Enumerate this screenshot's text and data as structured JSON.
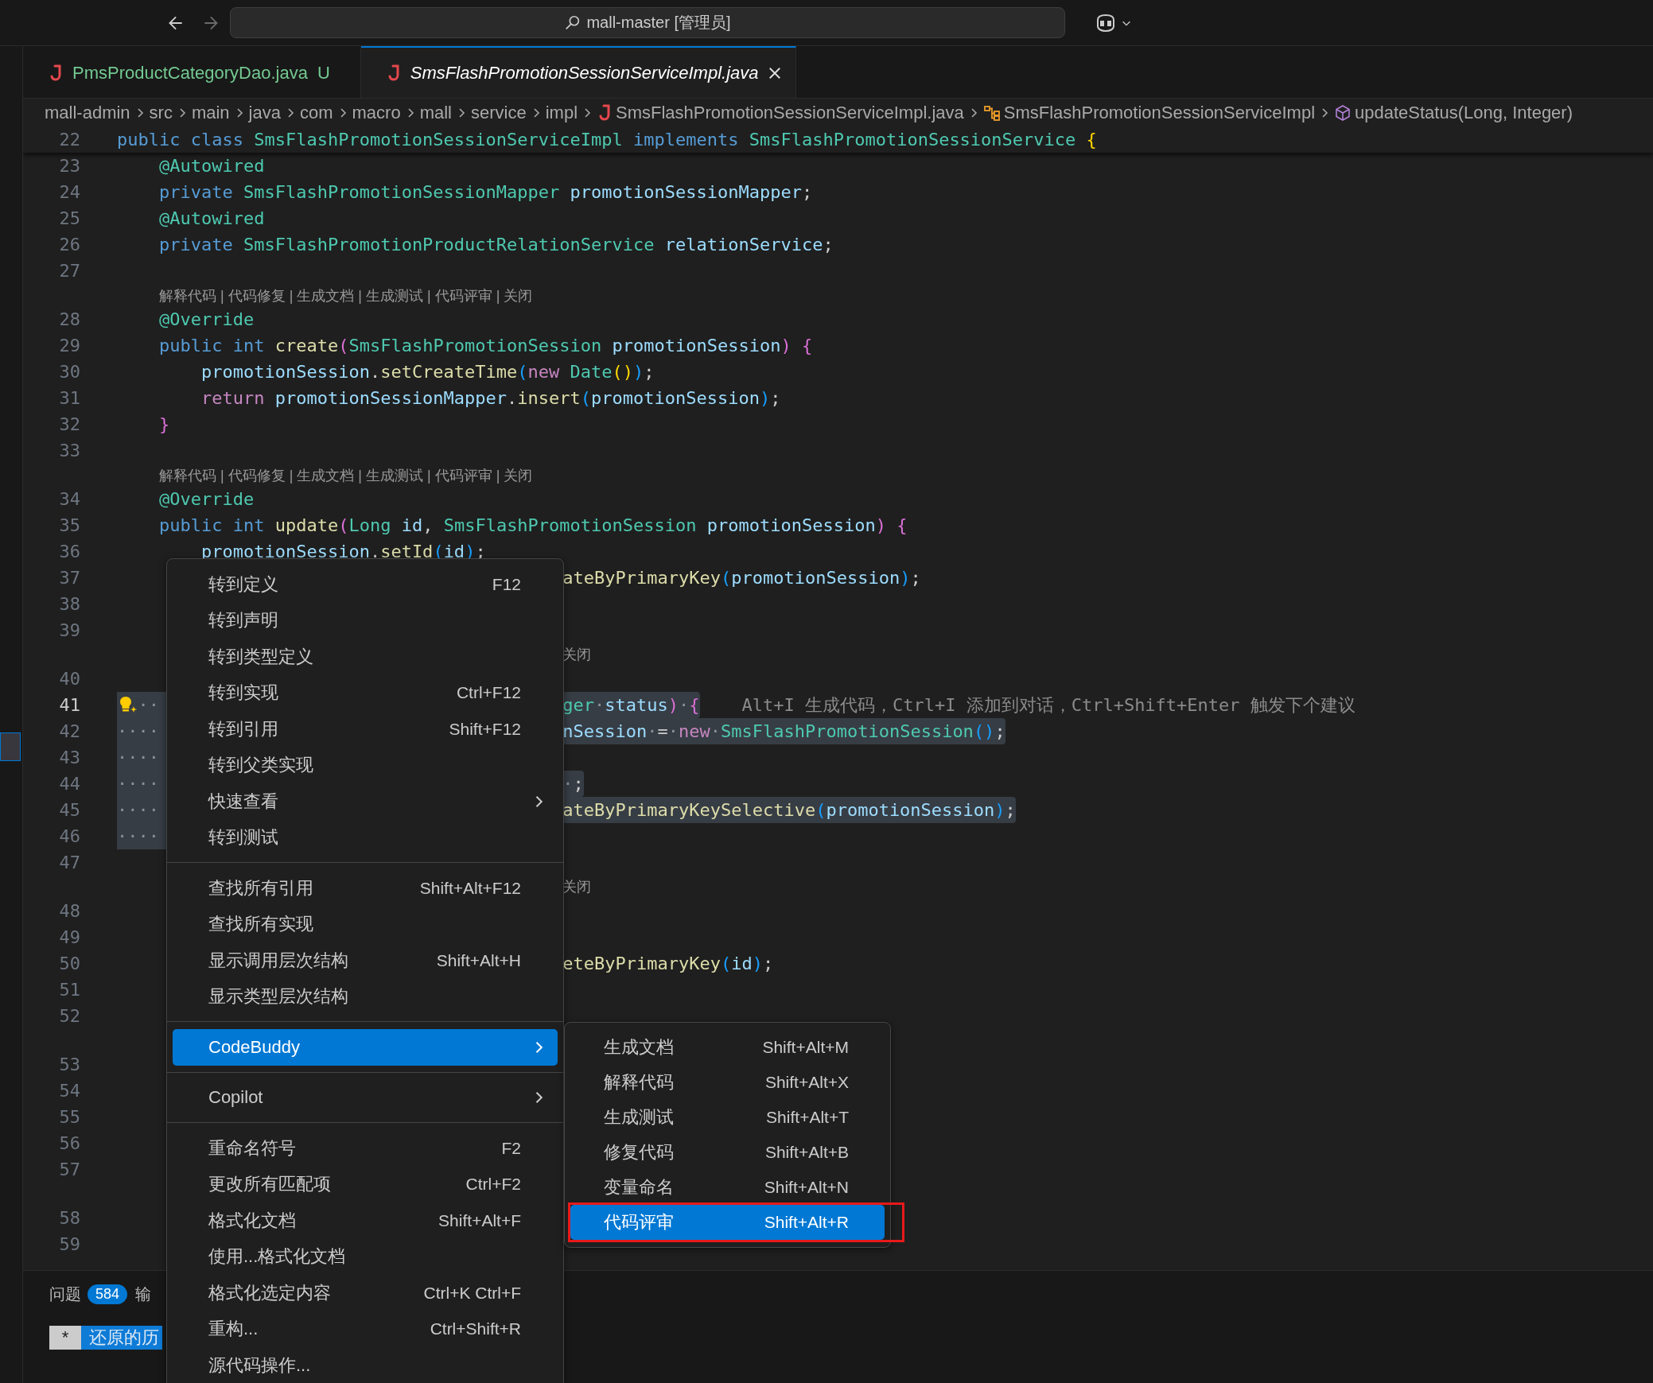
{
  "title_bar": {
    "back": {
      "disabled": false
    },
    "forward": {
      "disabled": true
    },
    "search": {
      "value": "mall-master [管理员]"
    }
  },
  "tabs": [
    {
      "label": "PmsProductCategoryDao.java",
      "status": "U",
      "untracked": true,
      "preview": false,
      "selected": false
    },
    {
      "label": "SmsFlashPromotionSessionServiceImpl.java",
      "untracked": false,
      "preview": true,
      "selected": true
    }
  ],
  "breadcrumb": [
    {
      "label": "mall-admin",
      "kind": "folder"
    },
    {
      "label": "src",
      "kind": "folder"
    },
    {
      "label": "main",
      "kind": "folder"
    },
    {
      "label": "java",
      "kind": "folder"
    },
    {
      "label": "com",
      "kind": "folder"
    },
    {
      "label": "macro",
      "kind": "folder"
    },
    {
      "label": "mall",
      "kind": "folder"
    },
    {
      "label": "service",
      "kind": "folder"
    },
    {
      "label": "impl",
      "kind": "folder"
    },
    {
      "label": "SmsFlashPromotionSessionServiceImpl.java",
      "kind": "file"
    },
    {
      "label": "SmsFlashPromotionSessionServiceImpl",
      "kind": "class"
    },
    {
      "label": "updateStatus(Long, Integer)",
      "kind": "method"
    }
  ],
  "editor": {
    "rows": [
      {
        "kind": "line",
        "number": "22",
        "sticky": true,
        "current": false,
        "selected": false,
        "left": [
          {
            "text": "public class ",
            "kind": "kw"
          },
          {
            "text": "SmsFlashPromotionSessionServiceImpl ",
            "kind": "type"
          },
          {
            "text": "implements ",
            "kind": "kw"
          },
          {
            "text": "SmsFlashPromotionSessionService ",
            "kind": "type"
          },
          {
            "text": "{",
            "kind": "b1"
          }
        ]
      },
      {
        "kind": "line",
        "number": "23",
        "current": false,
        "selected": false,
        "left": [
          {
            "text": "    @Autowired",
            "kind": "type"
          }
        ]
      },
      {
        "kind": "line",
        "number": "24",
        "current": false,
        "selected": false,
        "left": [
          {
            "text": "    private ",
            "kind": "kw"
          },
          {
            "text": "SmsFlashPromotionSessionMapper ",
            "kind": "type"
          },
          {
            "text": "promotionSessionMapper",
            "kind": "var"
          },
          {
            "text": ";",
            "kind": "punc"
          }
        ]
      },
      {
        "kind": "line",
        "number": "25",
        "current": false,
        "selected": false,
        "left": [
          {
            "text": "    @Autowired",
            "kind": "type"
          }
        ]
      },
      {
        "kind": "line",
        "number": "26",
        "current": false,
        "selected": false,
        "left": [
          {
            "text": "    private ",
            "kind": "kw"
          },
          {
            "text": "SmsFlashPromotionProductRelationService ",
            "kind": "type"
          },
          {
            "text": "relationService",
            "kind": "var"
          },
          {
            "text": ";",
            "kind": "punc"
          }
        ]
      },
      {
        "kind": "line",
        "number": "27",
        "current": false,
        "selected": false
      },
      {
        "kind": "lens",
        "left": "解释代码 | 代码修复 | 生成文档 | 生成测试 | 代码评审 | 关闭"
      },
      {
        "kind": "line",
        "number": "28",
        "current": false,
        "selected": false,
        "left": [
          {
            "text": "    @Override",
            "kind": "type"
          }
        ]
      },
      {
        "kind": "line",
        "number": "29",
        "current": false,
        "selected": false,
        "left": [
          {
            "text": "    public int ",
            "kind": "kw"
          },
          {
            "text": "create",
            "kind": "fn"
          },
          {
            "text": "(",
            "kind": "b2"
          },
          {
            "text": "SmsFlashPromotionSession ",
            "kind": "type"
          },
          {
            "text": "promotionSession",
            "kind": "var"
          },
          {
            "text": ") {",
            "kind": "b2"
          }
        ]
      },
      {
        "kind": "line",
        "number": "30",
        "current": false,
        "selected": false,
        "left": [
          {
            "text": "        promotionSession",
            "kind": "var"
          },
          {
            "text": ".",
            "kind": "punc"
          },
          {
            "text": "setCreateTime",
            "kind": "fn"
          },
          {
            "text": "(",
            "kind": "b3"
          },
          {
            "text": "new ",
            "kind": "ctrl"
          },
          {
            "text": "Date",
            "kind": "type"
          },
          {
            "text": "()",
            "kind": "b1"
          },
          {
            "text": ")",
            "kind": "b3"
          },
          {
            "text": ";",
            "kind": "punc"
          }
        ]
      },
      {
        "kind": "line",
        "number": "31",
        "current": false,
        "selected": false,
        "left": [
          {
            "text": "        return ",
            "kind": "ctrl"
          },
          {
            "text": "promotionSessionMapper",
            "kind": "var"
          },
          {
            "text": ".",
            "kind": "punc"
          },
          {
            "text": "insert",
            "kind": "fn"
          },
          {
            "text": "(",
            "kind": "b3"
          },
          {
            "text": "promotionSession",
            "kind": "var"
          },
          {
            "text": ")",
            "kind": "b3"
          },
          {
            "text": ";",
            "kind": "punc"
          }
        ]
      },
      {
        "kind": "line",
        "number": "32",
        "current": false,
        "selected": false,
        "left": [
          {
            "text": "    }",
            "kind": "b2"
          }
        ]
      },
      {
        "kind": "line",
        "number": "33",
        "current": false,
        "selected": false
      },
      {
        "kind": "lens",
        "left": "解释代码 | 代码修复 | 生成文档 | 生成测试 | 代码评审 | 关闭"
      },
      {
        "kind": "line",
        "number": "34",
        "current": false,
        "selected": false,
        "left": [
          {
            "text": "    @Override",
            "kind": "type"
          }
        ]
      },
      {
        "kind": "line",
        "number": "35",
        "current": false,
        "selected": false,
        "left": [
          {
            "text": "    public int ",
            "kind": "kw"
          },
          {
            "text": "update",
            "kind": "fn"
          },
          {
            "text": "(",
            "kind": "b2"
          },
          {
            "text": "Long ",
            "kind": "type"
          },
          {
            "text": "id",
            "kind": "var"
          },
          {
            "text": ", ",
            "kind": "punc"
          },
          {
            "text": "SmsFlashPromotionSession ",
            "kind": "type"
          },
          {
            "text": "promotionSession",
            "kind": "var"
          },
          {
            "text": ") {",
            "kind": "b2"
          }
        ]
      },
      {
        "kind": "line",
        "number": "36",
        "current": false,
        "selected": false,
        "left": [
          {
            "text": "        promotionSession",
            "kind": "var"
          },
          {
            "text": ".",
            "kind": "punc"
          },
          {
            "text": "setId",
            "kind": "fn"
          },
          {
            "text": "(",
            "kind": "b3"
          },
          {
            "text": "id",
            "kind": "var"
          },
          {
            "text": ")",
            "kind": "b3"
          },
          {
            "text": ";",
            "kind": "punc"
          }
        ]
      },
      {
        "kind": "line",
        "number": "37",
        "current": false,
        "selected": false,
        "right": [
          {
            "text": "ateByPrimaryKey",
            "kind": "fn"
          },
          {
            "text": "(",
            "kind": "b3"
          },
          {
            "text": "promotionSession",
            "kind": "var"
          },
          {
            "text": ")",
            "kind": "b3"
          },
          {
            "text": ";",
            "kind": "punc"
          }
        ]
      },
      {
        "kind": "line",
        "number": "38",
        "current": false,
        "selected": false
      },
      {
        "kind": "line",
        "number": "39",
        "current": false,
        "selected": false
      },
      {
        "kind": "lens",
        "right": "关闭"
      },
      {
        "kind": "line",
        "number": "40",
        "current": false,
        "selected": false
      },
      {
        "kind": "line",
        "number": "41",
        "current": true,
        "selected": true,
        "lightbulb": true,
        "left": [
          {
            "text": "  ··",
            "kind": "ws"
          }
        ],
        "right": [
          {
            "text": "ger",
            "kind": "type"
          },
          {
            "text": "·",
            "kind": "ws"
          },
          {
            "text": "status",
            "kind": "var"
          },
          {
            "text": ")",
            "kind": "b2"
          },
          {
            "text": "·",
            "kind": "ws"
          },
          {
            "text": "{",
            "kind": "b2"
          }
        ],
        "hint": "Alt+I 生成代码，Ctrl+I 添加到对话，Ctrl+Shift+Enter 触发下个建议"
      },
      {
        "kind": "line",
        "number": "42",
        "current": false,
        "selected": true,
        "left": [
          {
            "text": "····",
            "kind": "ws"
          }
        ],
        "right": [
          {
            "text": "nSession",
            "kind": "var"
          },
          {
            "text": "·",
            "kind": "ws"
          },
          {
            "text": "=",
            "kind": "punc"
          },
          {
            "text": "·",
            "kind": "ws"
          },
          {
            "text": "new",
            "kind": "ctrl"
          },
          {
            "text": "·",
            "kind": "ws"
          },
          {
            "text": "SmsFlashPromotionSession",
            "kind": "type"
          },
          {
            "text": "()",
            "kind": "b3"
          },
          {
            "text": ";",
            "kind": "punc"
          }
        ]
      },
      {
        "kind": "line",
        "number": "43",
        "current": false,
        "selected": true,
        "left": [
          {
            "text": "····",
            "kind": "ws"
          }
        ]
      },
      {
        "kind": "line",
        "number": "44",
        "current": false,
        "selected": true,
        "left": [
          {
            "text": "····",
            "kind": "ws"
          }
        ],
        "right": [
          {
            "text": "·",
            "kind": "ws"
          },
          {
            "text": ";",
            "kind": "punc"
          }
        ]
      },
      {
        "kind": "line",
        "number": "45",
        "current": false,
        "selected": true,
        "left": [
          {
            "text": "····",
            "kind": "ws"
          }
        ],
        "right": [
          {
            "text": "ateByPrimaryKeySelective",
            "kind": "fn"
          },
          {
            "text": "(",
            "kind": "b3"
          },
          {
            "text": "promotionSession",
            "kind": "var"
          },
          {
            "text": ")",
            "kind": "b3"
          },
          {
            "text": ";",
            "kind": "punc"
          }
        ]
      },
      {
        "kind": "line",
        "number": "46",
        "current": false,
        "selected": true,
        "left": [
          {
            "text": "····",
            "kind": "ws"
          }
        ]
      },
      {
        "kind": "line",
        "number": "47",
        "current": false,
        "selected": false
      },
      {
        "kind": "lens",
        "right": "关闭"
      },
      {
        "kind": "line",
        "number": "48",
        "current": false,
        "selected": false
      },
      {
        "kind": "line",
        "number": "49",
        "current": false,
        "selected": false
      },
      {
        "kind": "line",
        "number": "50",
        "current": false,
        "selected": false,
        "right": [
          {
            "text": "eteByPrimaryKey",
            "kind": "fn"
          },
          {
            "text": "(",
            "kind": "b3"
          },
          {
            "text": "id",
            "kind": "var"
          },
          {
            "text": ")",
            "kind": "b3"
          },
          {
            "text": ";",
            "kind": "punc"
          }
        ]
      },
      {
        "kind": "line",
        "number": "51",
        "current": false,
        "selected": false
      },
      {
        "kind": "line",
        "number": "52",
        "current": false,
        "selected": false
      },
      {
        "kind": "lens"
      },
      {
        "kind": "line",
        "number": "53",
        "current": false,
        "selected": false
      },
      {
        "kind": "line",
        "number": "54",
        "current": false,
        "selected": false
      },
      {
        "kind": "line",
        "number": "55",
        "current": false,
        "selected": false
      },
      {
        "kind": "line",
        "number": "56",
        "current": false,
        "selected": false
      },
      {
        "kind": "line",
        "number": "57",
        "current": false,
        "selected": false
      },
      {
        "kind": "lens"
      },
      {
        "kind": "line",
        "number": "58",
        "current": false,
        "selected": false
      },
      {
        "kind": "line",
        "number": "59",
        "current": false,
        "selected": false
      }
    ]
  },
  "panel": {
    "tabs": [
      {
        "label": "问题",
        "badge": "584"
      },
      {
        "label": "输"
      }
    ],
    "output": {
      "marker": "*",
      "text": "还原的历"
    }
  },
  "context_menu": {
    "groups": [
      [
        {
          "label": "转到定义",
          "shortcut": "F12",
          "submenu": false,
          "selected": false
        },
        {
          "label": "转到声明",
          "submenu": false,
          "selected": false
        },
        {
          "label": "转到类型定义",
          "submenu": false,
          "selected": false
        },
        {
          "label": "转到实现",
          "shortcut": "Ctrl+F12",
          "submenu": false,
          "selected": false
        },
        {
          "label": "转到引用",
          "shortcut": "Shift+F12",
          "submenu": false,
          "selected": false
        },
        {
          "label": "转到父类实现",
          "submenu": false,
          "selected": false
        },
        {
          "label": "快速查看",
          "submenu": true,
          "selected": false
        },
        {
          "label": "转到测试",
          "submenu": false,
          "selected": false
        }
      ],
      [
        {
          "label": "查找所有引用",
          "shortcut": "Shift+Alt+F12",
          "submenu": false,
          "selected": false
        },
        {
          "label": "查找所有实现",
          "submenu": false,
          "selected": false
        },
        {
          "label": "显示调用层次结构",
          "shortcut": "Shift+Alt+H",
          "submenu": false,
          "selected": false
        },
        {
          "label": "显示类型层次结构",
          "submenu": false,
          "selected": false
        }
      ],
      [
        {
          "label": "CodeBuddy",
          "submenu": true,
          "selected": true
        }
      ],
      [
        {
          "label": "Copilot",
          "submenu": true,
          "selected": false
        }
      ],
      [
        {
          "label": "重命名符号",
          "shortcut": "F2",
          "submenu": false,
          "selected": false
        },
        {
          "label": "更改所有匹配项",
          "shortcut": "Ctrl+F2",
          "submenu": false,
          "selected": false
        },
        {
          "label": "格式化文档",
          "shortcut": "Shift+Alt+F",
          "submenu": false,
          "selected": false
        },
        {
          "label": "使用...格式化文档",
          "submenu": false,
          "selected": false
        },
        {
          "label": "格式化选定内容",
          "shortcut": "Ctrl+K Ctrl+F",
          "submenu": false,
          "selected": false
        },
        {
          "label": "重构...",
          "shortcut": "Ctrl+Shift+R",
          "submenu": false,
          "selected": false
        },
        {
          "label": "源代码操作...",
          "submenu": false,
          "selected": false
        }
      ]
    ]
  },
  "submenu": {
    "items": [
      {
        "label": "生成文档",
        "shortcut": "Shift+Alt+M",
        "selected": false,
        "marked": false
      },
      {
        "label": "解释代码",
        "shortcut": "Shift+Alt+X",
        "selected": false,
        "marked": false
      },
      {
        "label": "生成测试",
        "shortcut": "Shift+Alt+T",
        "selected": false,
        "marked": false
      },
      {
        "label": "修复代码",
        "shortcut": "Shift+Alt+B",
        "selected": false,
        "marked": false
      },
      {
        "label": "变量命名",
        "shortcut": "Shift+Alt+N",
        "selected": false,
        "marked": false
      },
      {
        "label": "代码评审",
        "shortcut": "Shift+Alt+R",
        "selected": true,
        "marked": true
      }
    ]
  }
}
